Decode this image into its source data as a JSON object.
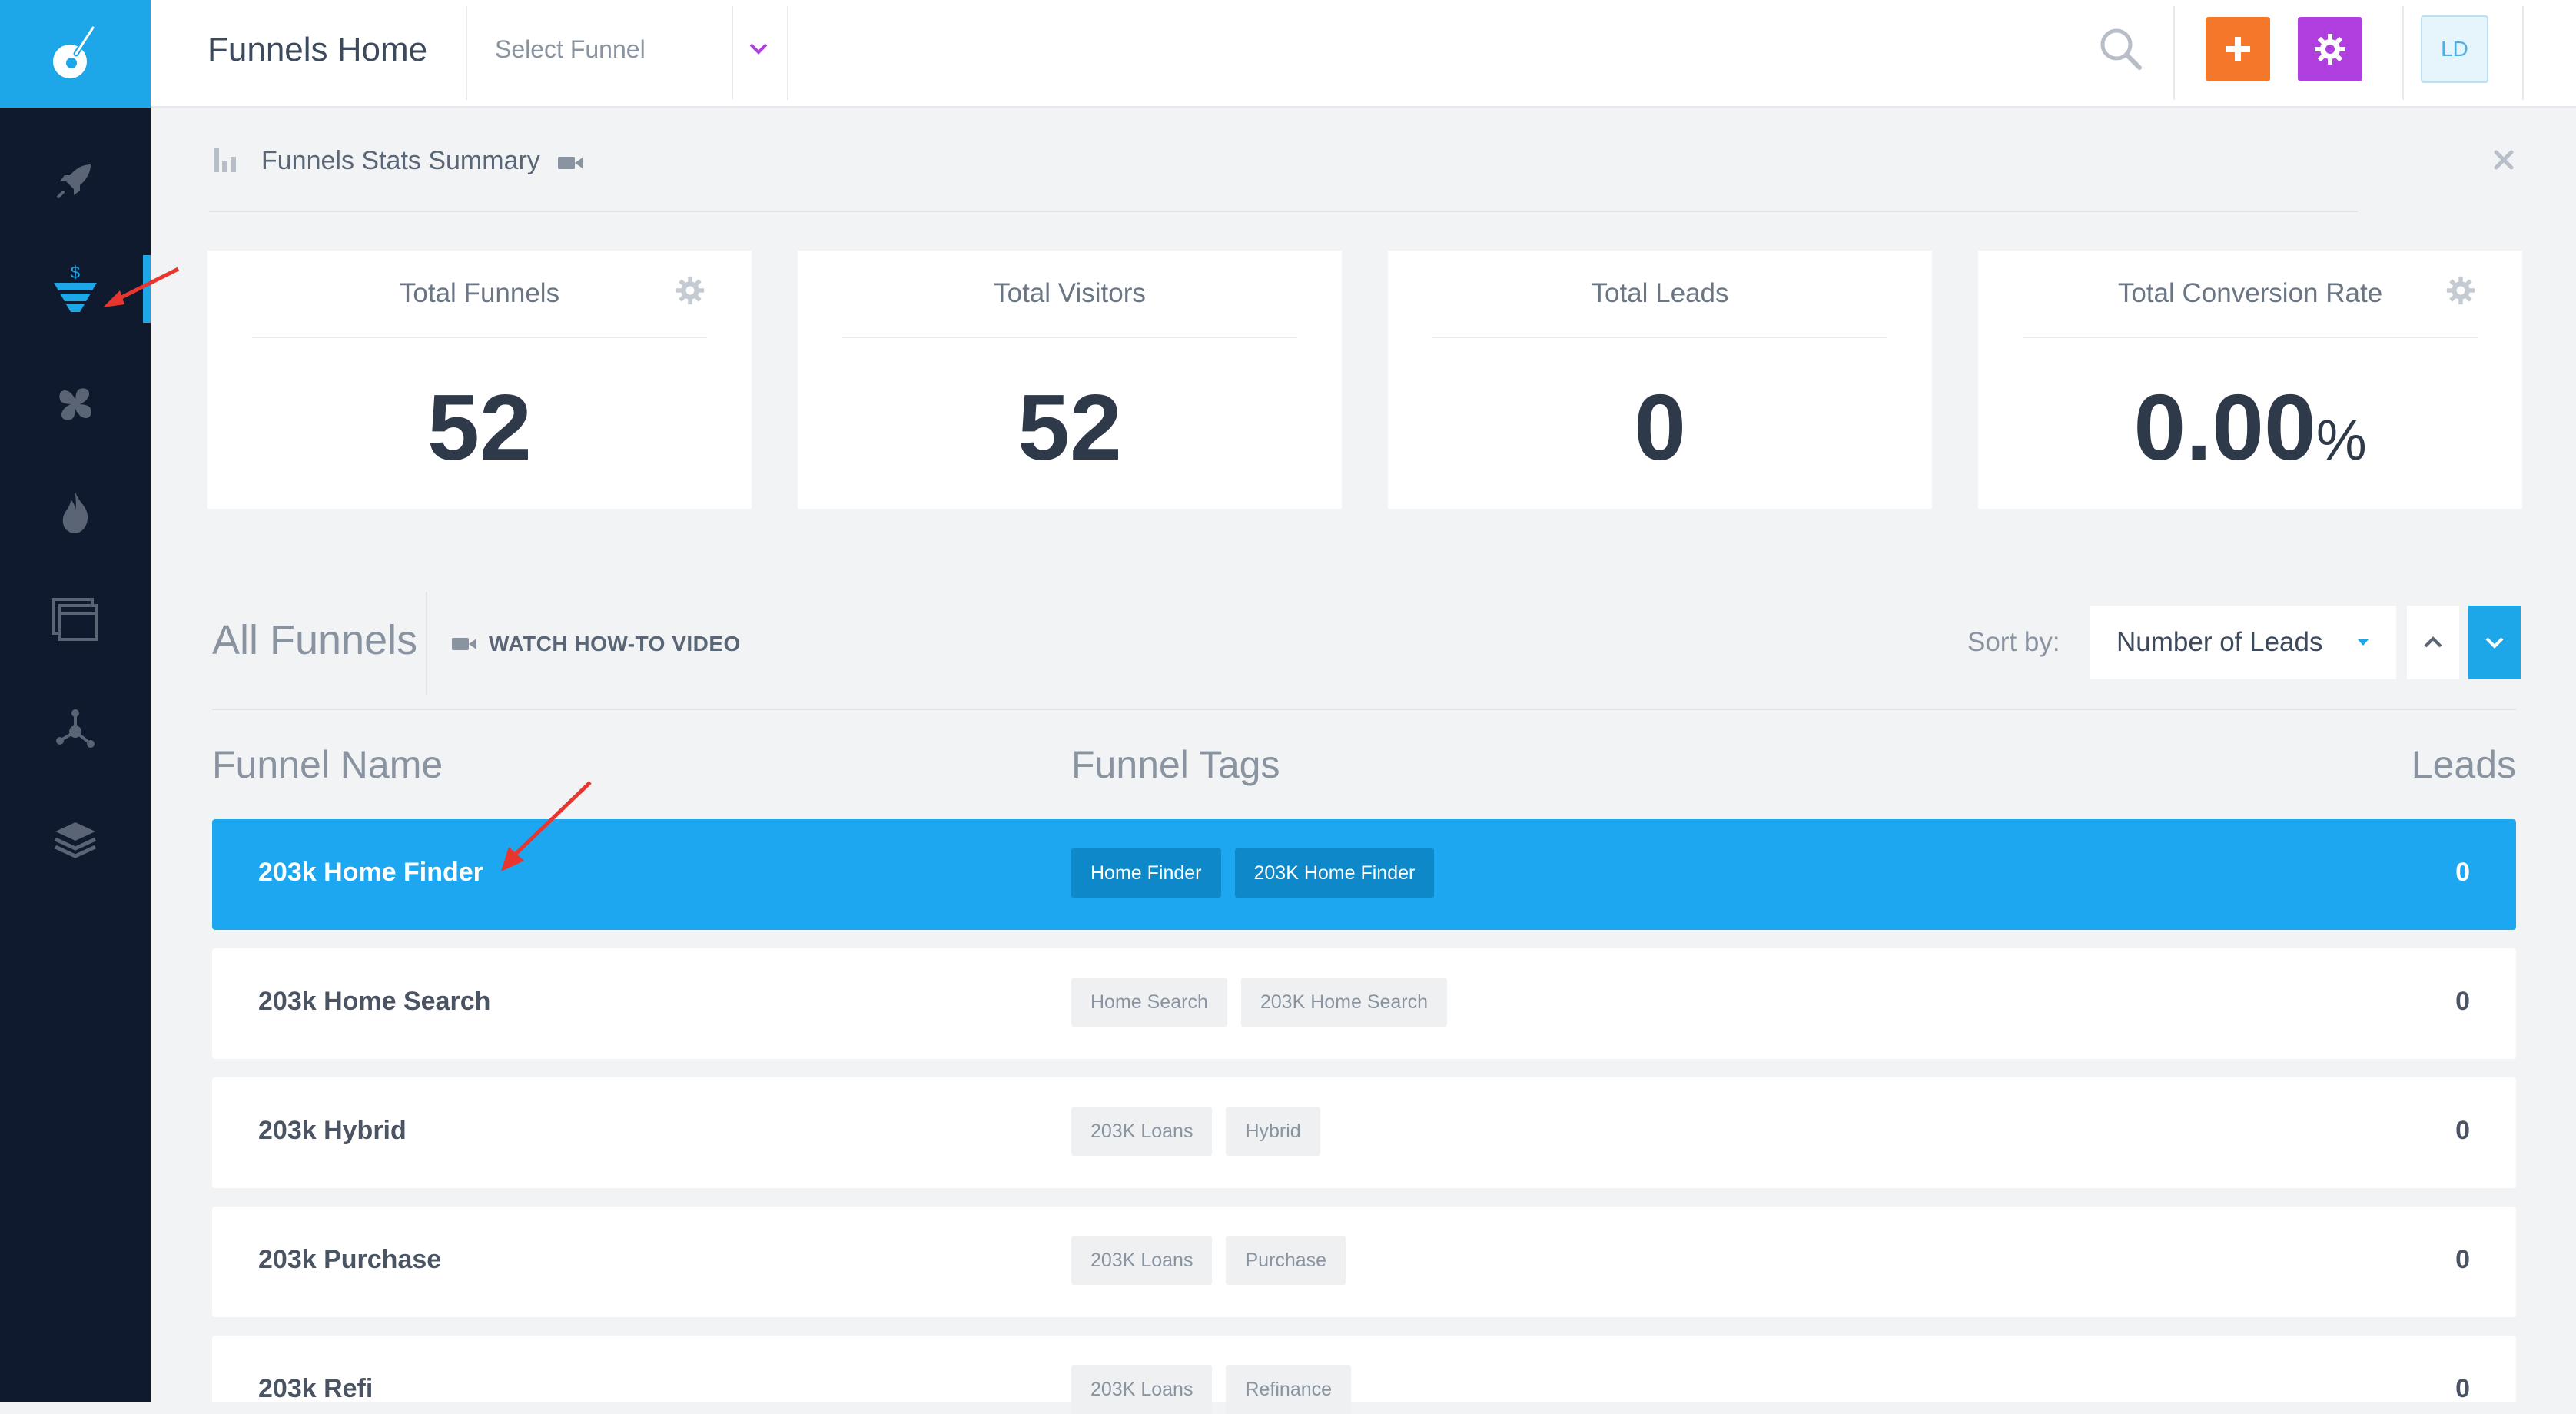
{
  "header": {
    "title": "Funnels Home",
    "select_funnel_placeholder": "Select Funnel",
    "avatar_initials": "LD"
  },
  "stats": {
    "title": "Funnels Stats Summary",
    "cards": [
      {
        "label": "Total Funnels",
        "value": "52"
      },
      {
        "label": "Total Visitors",
        "value": "52"
      },
      {
        "label": "Total Leads",
        "value": "0"
      },
      {
        "label": "Total Conversion Rate",
        "value": "0.00",
        "unit": "%"
      }
    ]
  },
  "funnels": {
    "title": "All Funnels",
    "watch_video_label": "WATCH HOW-TO VIDEO",
    "sort_label": "Sort by:",
    "sort_value": "Number of Leads",
    "columns": {
      "name": "Funnel Name",
      "tags": "Funnel Tags",
      "leads": "Leads"
    },
    "rows": [
      {
        "name": "203k Home Finder",
        "tags": [
          "Home Finder",
          "203K Home Finder"
        ],
        "leads": "0",
        "selected": true
      },
      {
        "name": "203k Home Search",
        "tags": [
          "Home Search",
          "203K Home Search"
        ],
        "leads": "0"
      },
      {
        "name": "203k Hybrid",
        "tags": [
          "203K Loans",
          "Hybrid"
        ],
        "leads": "0"
      },
      {
        "name": "203k Purchase",
        "tags": [
          "203K Loans",
          "Purchase"
        ],
        "leads": "0"
      },
      {
        "name": "203k Refi",
        "tags": [
          "203K Loans",
          "Refinance"
        ],
        "leads": "0"
      }
    ]
  },
  "sidebar": {
    "items": [
      "rocket-icon",
      "funnel-icon",
      "puzzle-icon",
      "fire-icon",
      "window-icon",
      "share-icon",
      "layers-icon"
    ],
    "active": "funnel-icon"
  },
  "colors": {
    "sidebar_bg": "#0f1a2e",
    "accent_blue": "#1da7e8",
    "add_button": "#f5782a",
    "settings_button": "#b13fe0",
    "annotation_arrow": "#e8352e"
  }
}
